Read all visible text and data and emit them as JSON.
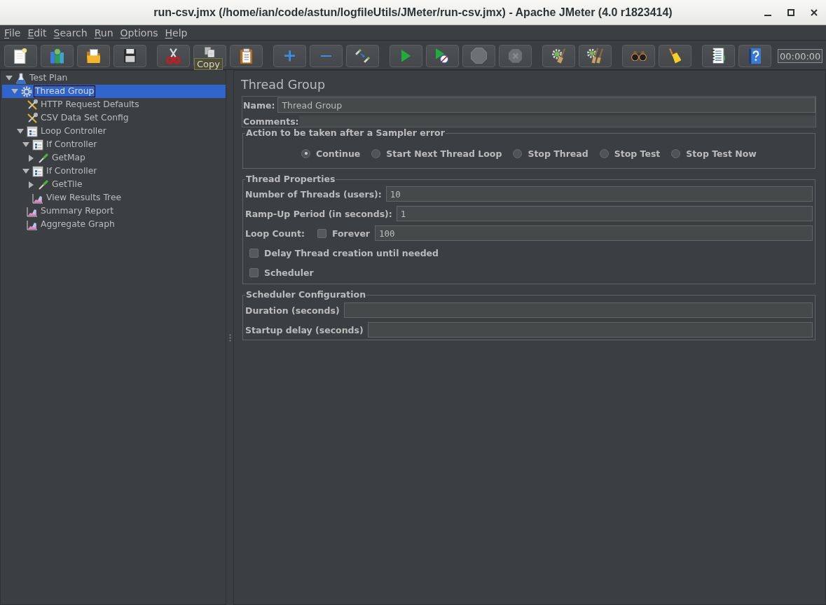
{
  "window": {
    "title": "run-csv.jmx (/home/ian/code/astun/logfileUtils/JMeter/run-csv.jmx) - Apache JMeter (4.0 r1823414)"
  },
  "menu": [
    "File",
    "Edit",
    "Search",
    "Run",
    "Options",
    "Help"
  ],
  "toolbar": {
    "groups": [
      {
        "buttons": [
          {
            "kind": "new",
            "disabled": false
          },
          {
            "kind": "templates",
            "disabled": false
          },
          {
            "kind": "open",
            "disabled": false
          },
          {
            "kind": "save",
            "disabled": false
          }
        ]
      },
      {
        "buttons": [
          {
            "kind": "cut",
            "disabled": false
          },
          {
            "kind": "copy",
            "disabled": false,
            "tooltip": "Copy"
          },
          {
            "kind": "paste",
            "disabled": false
          }
        ]
      },
      {
        "buttons": [
          {
            "kind": "expand",
            "disabled": false
          },
          {
            "kind": "collapse",
            "disabled": false
          },
          {
            "kind": "toggle",
            "disabled": false
          }
        ]
      },
      {
        "buttons": [
          {
            "kind": "start",
            "disabled": false
          },
          {
            "kind": "nopauses",
            "disabled": false
          },
          {
            "kind": "stop",
            "disabled": true
          },
          {
            "kind": "shutdown",
            "disabled": true
          }
        ]
      },
      {
        "buttons": [
          {
            "kind": "clear",
            "disabled": false
          },
          {
            "kind": "clearall",
            "disabled": false
          }
        ]
      },
      {
        "buttons": [
          {
            "kind": "search",
            "disabled": false
          },
          {
            "kind": "reset",
            "disabled": false
          }
        ]
      },
      {
        "buttons": [
          {
            "kind": "functions",
            "disabled": false
          },
          {
            "kind": "help",
            "disabled": false
          }
        ]
      }
    ],
    "timer": "00:00:00"
  },
  "tree": [
    {
      "label": "Test Plan",
      "kind": "plan",
      "expanded": true,
      "selected": false,
      "children": [
        {
          "label": "Thread Group",
          "kind": "threads",
          "expanded": true,
          "selected": true,
          "children": [
            {
              "label": "HTTP Request Defaults",
              "kind": "config",
              "selected": false
            },
            {
              "label": "CSV Data Set Config",
              "kind": "config",
              "selected": false
            },
            {
              "label": "Loop Controller",
              "kind": "controller",
              "expanded": true,
              "selected": false,
              "children": [
                {
                  "label": "If Controller",
                  "kind": "controller",
                  "expanded": true,
                  "selected": false,
                  "children": [
                    {
                      "label": "GetMap",
                      "kind": "sampler",
                      "expanded": false,
                      "selected": false
                    }
                  ]
                },
                {
                  "label": "If Controller",
                  "kind": "controller",
                  "expanded": true,
                  "selected": false,
                  "children": [
                    {
                      "label": "GetTile",
                      "kind": "sampler",
                      "expanded": false,
                      "selected": false
                    }
                  ]
                },
                {
                  "label": "View Results Tree",
                  "kind": "listener",
                  "selected": false
                }
              ]
            },
            {
              "label": "Summary Report",
              "kind": "listener",
              "selected": false
            },
            {
              "label": "Aggregate Graph",
              "kind": "listener",
              "selected": false
            }
          ]
        }
      ]
    }
  ],
  "editor": {
    "title": "Thread Group",
    "name": {
      "label": "Name:",
      "value": "Thread Group"
    },
    "comments": {
      "label": "Comments:"
    },
    "error_action": {
      "legend": "Action to be taken after a Sampler error",
      "options": [
        {
          "label": "Continue",
          "selected": true
        },
        {
          "label": "Start Next Thread Loop",
          "selected": false
        },
        {
          "label": "Stop Thread",
          "selected": false
        },
        {
          "label": "Stop Test",
          "selected": false
        },
        {
          "label": "Stop Test Now",
          "selected": false
        }
      ]
    },
    "thread_properties": {
      "legend": "Thread Properties",
      "rows": [
        {
          "kind": "field",
          "label": "Number of Threads (users):",
          "value": "10"
        },
        {
          "kind": "field",
          "label": "Ramp-Up Period (in seconds):",
          "value": "1"
        },
        {
          "kind": "loop",
          "label": "Loop Count:",
          "forever": {
            "label": "Forever",
            "checked": false
          },
          "value": "100"
        },
        {
          "kind": "checkbox",
          "label": "Delay Thread creation until needed",
          "checked": false
        },
        {
          "kind": "checkbox",
          "label": "Scheduler",
          "checked": false
        }
      ]
    },
    "scheduler_configuration": {
      "legend": "Scheduler Configuration",
      "fields": [
        {
          "label": "Duration (seconds)"
        },
        {
          "label": "Startup delay (seconds)"
        }
      ]
    }
  }
}
